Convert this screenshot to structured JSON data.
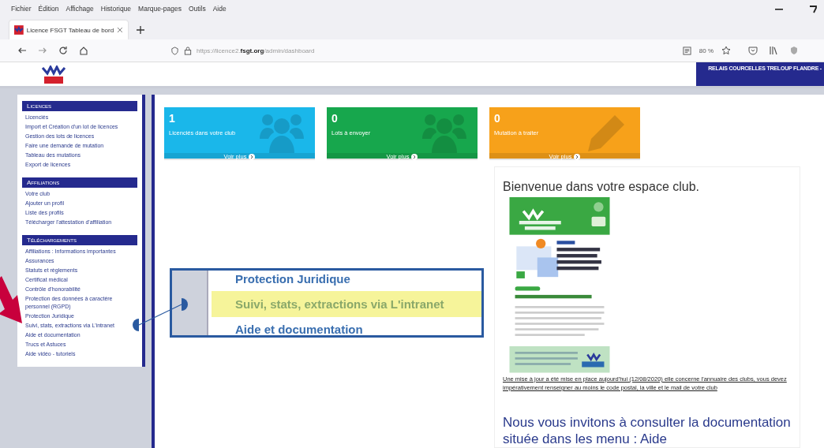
{
  "browser": {
    "menu": [
      "Fichier",
      "Édition",
      "Affichage",
      "Historique",
      "Marque-pages",
      "Outils",
      "Aide"
    ],
    "tab": {
      "title": "Licence FSGT Tableau de bord"
    },
    "url": {
      "prefix": "https://licence2.",
      "domain": "fsgt.org",
      "path": "/admin/dashboard"
    },
    "zoom": "80 %"
  },
  "header": {
    "club_name": "RELAIS COURCELLES TRELOUP FLANDRE -"
  },
  "sidebar": {
    "sections": [
      {
        "title": "Licences",
        "items": [
          "Licenciés",
          "Import et Création d'un lot de licences",
          "Gestion des lots de licences",
          "Faire une demande de mutation",
          "Tableau des mutations",
          "Export de licences"
        ]
      },
      {
        "title": "Affiliations",
        "items": [
          "Votre club",
          "Ajouter un profil",
          "Liste des profils",
          "Télécharger l'attestation d'affiliation"
        ]
      },
      {
        "title": "Téléchargements",
        "items": [
          "Affiliations : Informations importantes",
          "Assurances",
          "Statuts et règlements",
          "Certificat médical",
          "Contrôle d'honorabilité",
          "Protection des données à caractère personnel (RGPD)",
          "Protection Juridique",
          "Suivi, stats, extractions via L'intranet",
          "Aide et documentation",
          "Trucs et Astuces",
          "Aide vidéo - tutoriels"
        ]
      }
    ]
  },
  "cards": [
    {
      "count": "1",
      "label": "Licenciés dans votre club",
      "link": "Voir plus",
      "color": "#1ab7ea",
      "kind": "people"
    },
    {
      "count": "0",
      "label": "Lots à envoyer",
      "link": "Voir plus",
      "color": "#17a74d",
      "kind": "people"
    },
    {
      "count": "0",
      "label": "Mutation à traiter",
      "link": "Voir plus",
      "color": "#f7a11a",
      "kind": "pencil"
    }
  ],
  "welcome": {
    "title": "Bienvenue dans votre espace club.",
    "notice": "Une mise à jour a été mise en place aujourd'hui (12/08/2020) elle concerne l'annuaire des clubs, vous devez impérativement renseigner au moins le code postal, la ville et le mail de votre club",
    "invitation": "Nous vous invitons à consulter la documentation située dans les menu : Aide"
  },
  "callout": {
    "items": [
      {
        "label": "Protection Juridique",
        "highlighted": false
      },
      {
        "label": "Suivi, stats, extractions via L'intranet",
        "highlighted": true
      },
      {
        "label": "Aide et documentation",
        "highlighted": false
      }
    ]
  }
}
